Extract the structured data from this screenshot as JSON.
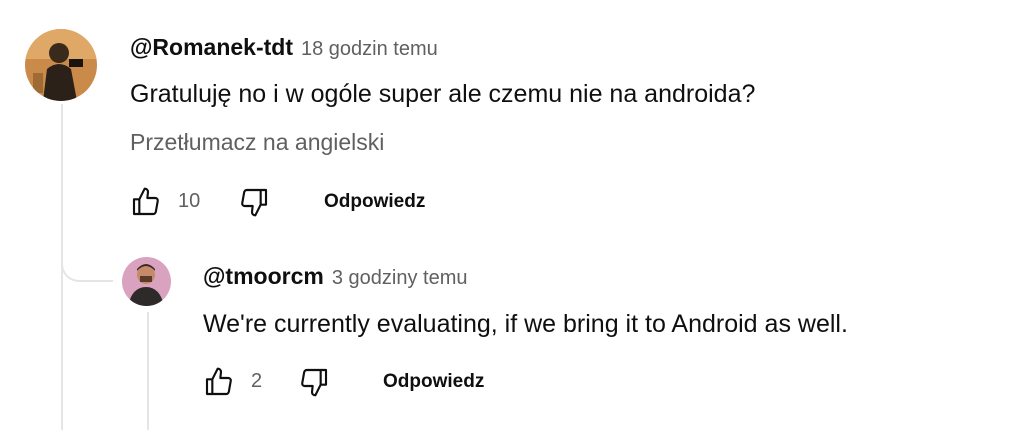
{
  "comment": {
    "author": "@Romanek-tdt",
    "time": "18 godzin temu",
    "text": "Gratuluję no i w ogóle super ale czemu nie na androida?",
    "translate_label": "Przetłumacz na angielski",
    "like_count": "10",
    "reply_label": "Odpowiedz",
    "avatar_icon": "user-avatar-photo"
  },
  "reply": {
    "author": "@tmoorcm",
    "time": "3 godziny temu",
    "text": "We're currently evaluating, if we bring it to Android as well.",
    "like_count": "2",
    "reply_label": "Odpowiedz",
    "avatar_icon": "user-avatar-photo"
  },
  "icons": {
    "like": "thumbs-up-icon",
    "dislike": "thumbs-down-icon"
  },
  "colors": {
    "text": "#0f0f0f",
    "secondary": "#606060",
    "thread_line": "#e5e5e5"
  }
}
